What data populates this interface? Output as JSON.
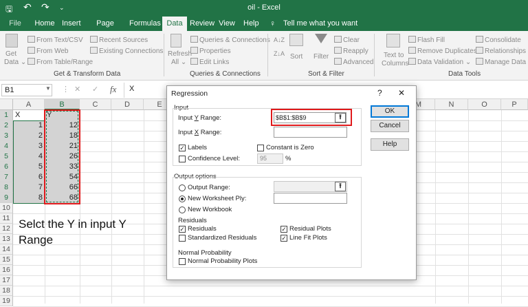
{
  "window": {
    "title": "oil  -  Excel",
    "qa_save": "🖫",
    "qa_undo": "↶",
    "qa_redo": "↷",
    "qa_more": "⌄"
  },
  "menu": {
    "tabs": [
      "File",
      "Home",
      "Insert",
      "Page Layout",
      "Formulas",
      "Data",
      "Review",
      "View",
      "Help"
    ],
    "active": "Data",
    "tell_me": "Tell me what you want to do"
  },
  "ribbon": {
    "get_data": [
      "Get",
      "Data ⌄"
    ],
    "from_text": "From Text/CSV",
    "from_web": "From Web",
    "from_table": "From Table/Range",
    "recent_sources": "Recent Sources",
    "existing_connections": "Existing Connections",
    "group_get": "Get & Transform Data",
    "refresh": [
      "Refresh",
      "All ⌄"
    ],
    "queries": "Queries & Connections",
    "properties": "Properties",
    "edit_links": "Edit Links",
    "group_queries": "Queries & Connections",
    "sort": "Sort",
    "filter": "Filter",
    "clear": "Clear",
    "reapply": "Reapply",
    "advanced": "Advanced",
    "group_sort": "Sort & Filter",
    "text_to_columns": [
      "Text to",
      "Columns"
    ],
    "flash_fill": "Flash Fill",
    "remove_duplicates": "Remove Duplicates",
    "data_validation": "Data Validation",
    "consolidate": "Consolidate",
    "relationships": "Relationships",
    "manage_data": "Manage Data M",
    "group_tools": "Data Tools"
  },
  "formula_bar": {
    "name_box": "B1",
    "fx": "fx",
    "content": "X",
    "cancel": "✕",
    "enter": "✓"
  },
  "sheet": {
    "columns": [
      "A",
      "B",
      "C",
      "D",
      "E",
      "M",
      "N",
      "O",
      "P"
    ],
    "rows": [
      "1",
      "2",
      "3",
      "4",
      "5",
      "6",
      "7",
      "8",
      "9",
      "10",
      "11",
      "12",
      "13",
      "14",
      "15",
      "16",
      "17",
      "18",
      "19"
    ],
    "a_values": [
      "X",
      "1",
      "2",
      "3",
      "4",
      "5",
      "6",
      "7",
      "8"
    ],
    "b_values": [
      "Y",
      "12",
      "18",
      "21",
      "26",
      "33",
      "54",
      "66",
      "68"
    ],
    "annotation": [
      "Selct the Y in input Y",
      "Range"
    ]
  },
  "dialog": {
    "title": "Regression",
    "help": "?",
    "close": "✕",
    "input_label": "Input",
    "input_y_label": "Input Y Range:",
    "input_y_value": "$B$1:$B$9",
    "input_x_label": "Input X Range:",
    "input_x_value": "",
    "labels": "Labels",
    "constant_zero": "Constant is Zero",
    "confidence": "Confidence Level:",
    "confidence_value": "95",
    "percent": "%",
    "output_options": "Output options",
    "output_range": "Output Range:",
    "new_ply": "New Worksheet Ply:",
    "new_workbook": "New Workbook",
    "residuals_group": "Residuals",
    "residuals": "Residuals",
    "std_residuals": "Standardized Residuals",
    "residual_plots": "Residual Plots",
    "line_fit": "Line Fit Plots",
    "normal_prob_group": "Normal Probability",
    "normal_prob": "Normal Probability Plots",
    "ok": "OK",
    "cancel": "Cancel",
    "help_btn": "Help",
    "collapse": "⭱",
    "checkmark": "✓"
  },
  "colors": {
    "excel_green": "#217346",
    "highlight": "#e0191b"
  }
}
